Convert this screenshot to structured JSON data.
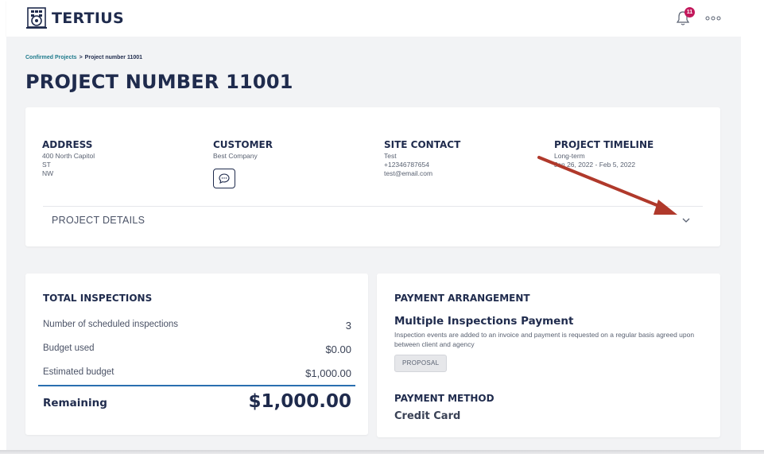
{
  "app": {
    "name": "TERTIUS",
    "notification_count": "11"
  },
  "breadcrumb": {
    "parent": "Confirmed Projects",
    "separator": ">",
    "current": "Project number 11001"
  },
  "page_title": "PROJECT NUMBER 11001",
  "info": {
    "address": {
      "heading": "ADDRESS",
      "lines": [
        "400 North Capitol",
        "ST",
        "NW"
      ]
    },
    "customer": {
      "heading": "CUSTOMER",
      "lines": [
        "Best Company"
      ]
    },
    "site_contact": {
      "heading": "SITE CONTACT",
      "lines": [
        "Test",
        "+12346787654",
        "test@email.com"
      ]
    },
    "timeline": {
      "heading": "PROJECT TIMELINE",
      "lines": [
        "Long-term",
        "Jan 26, 2022 - Feb 5, 2022"
      ]
    },
    "details_label": "PROJECT DETAILS"
  },
  "inspections": {
    "heading": "TOTAL INSPECTIONS",
    "rows": [
      {
        "label": "Number of scheduled inspections",
        "value": "3"
      },
      {
        "label": "Budget used",
        "value": "$0.00"
      },
      {
        "label": "Estimated budget",
        "value": "$1,000.00"
      }
    ],
    "remaining_label": "Remaining",
    "remaining_value": "$1,000.00"
  },
  "payment": {
    "heading": "PAYMENT ARRANGEMENT",
    "title": "Multiple Inspections Payment",
    "description": "Inspection events are added to an invoice and payment is requested on a regular basis agreed upon between client and agency",
    "tag": "PROPOSAL",
    "method_heading": "PAYMENT METHOD",
    "method_value": "Credit Card"
  },
  "colors": {
    "brand_navy": "#1f2b4d",
    "link_teal": "#1f7a8c",
    "badge": "#c2185b",
    "divider_blue": "#2a6fb0",
    "annotation_arrow": "#b0392b"
  },
  "icons": [
    "logo-building-icon",
    "bell-icon",
    "more-dots-icon",
    "chat-icon",
    "chevron-down-icon"
  ]
}
